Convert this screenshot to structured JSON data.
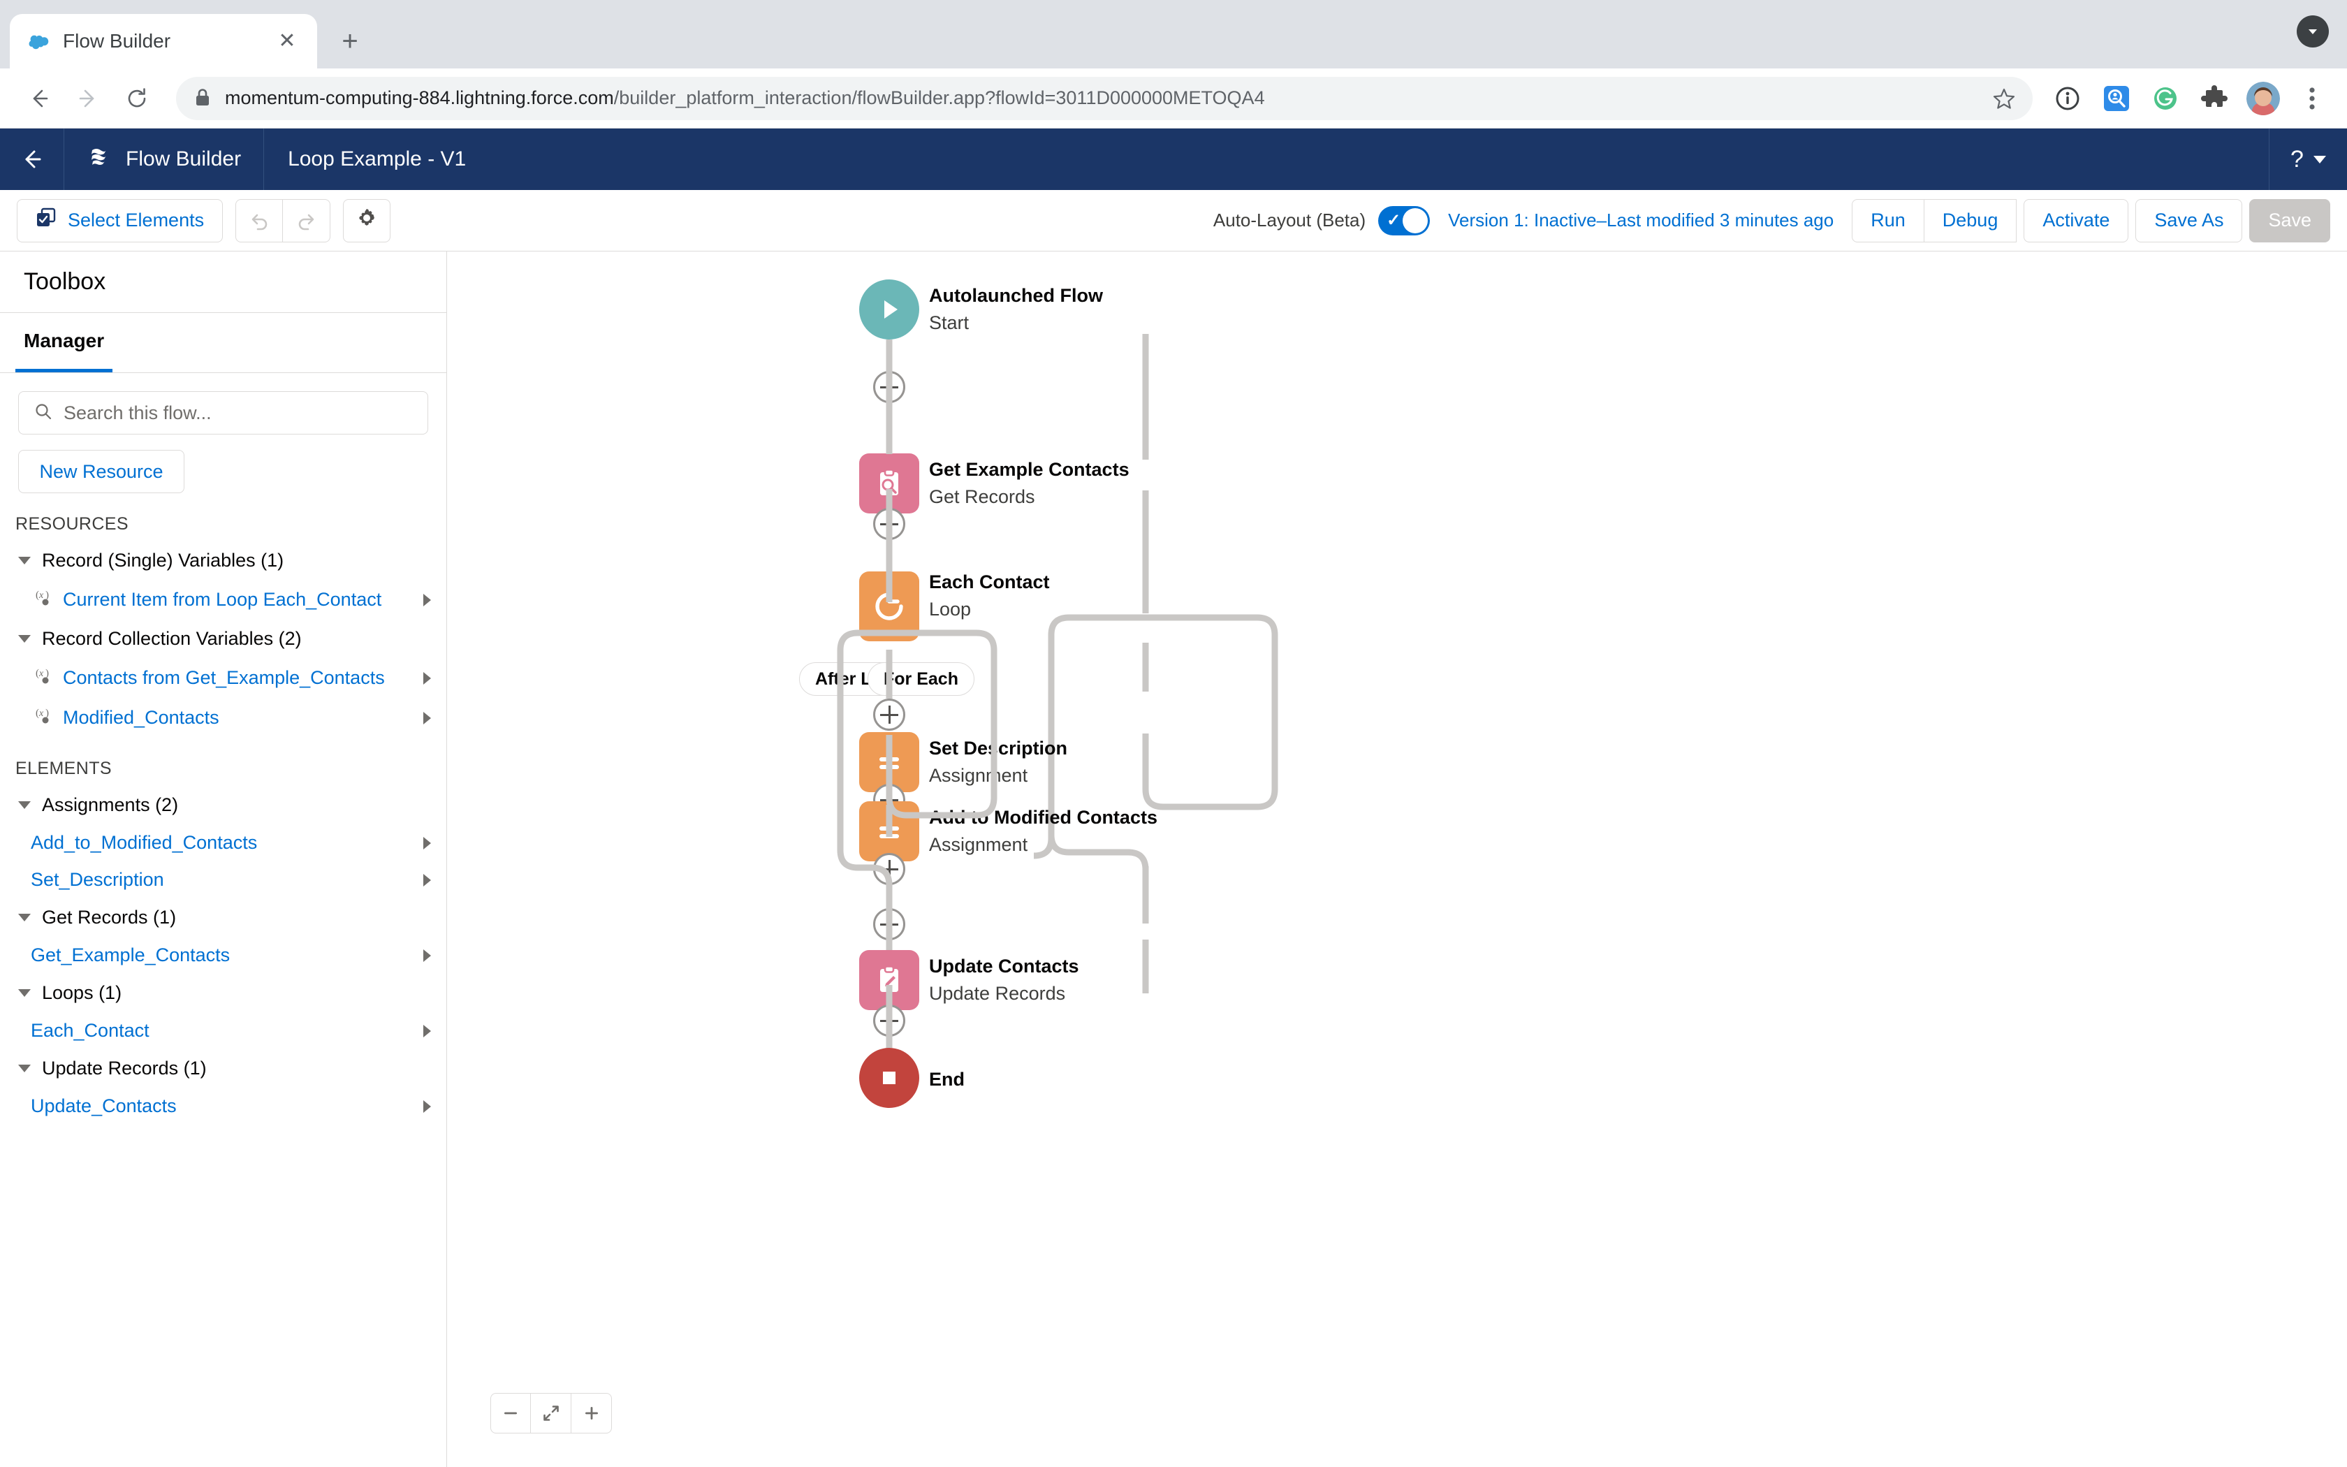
{
  "browser": {
    "tab": {
      "title": "Flow Builder",
      "favicon": "salesforce-cloud-icon",
      "close": "✕"
    },
    "new_tab": "+",
    "url": {
      "domain": "momentum-computing-884.lightning.force.com",
      "path": "/builder_platform_interaction/flowBuilder.app?flowId=3011D000000METOQA4"
    },
    "nav": {
      "back": "←",
      "forward": "→",
      "reload": "⟳"
    },
    "extensions": [
      "info-circle-icon",
      "search-person-icon",
      "grammarly-icon",
      "puzzle-extension-icon",
      "profile-avatar",
      "three-dot-menu-icon"
    ]
  },
  "sf_header": {
    "back_label": "←",
    "app_name": "Flow Builder",
    "app_icon": "flow-builder-icon",
    "flow_name": "Loop Example - V1",
    "help_label": "?"
  },
  "toolbar": {
    "select_elements": "Select Elements",
    "undo_label": "undo",
    "redo_label": "redo",
    "settings_label": "settings",
    "autolayout_label": "Auto-Layout (Beta)",
    "autolayout_on": true,
    "version_status": "Version 1: Inactive–Last modified 3 minutes ago",
    "run": "Run",
    "debug": "Debug",
    "activate": "Activate",
    "save_as": "Save As",
    "save": "Save"
  },
  "sidebar": {
    "title": "Toolbox",
    "tabs": [
      {
        "label": "Manager",
        "active": true
      }
    ],
    "search_placeholder": "Search this flow...",
    "new_resource": "New Resource",
    "resources_label": "RESOURCES",
    "resource_groups": [
      {
        "label": "Record (Single) Variables (1)",
        "items": [
          {
            "label": "Current Item from Loop Each_Contact",
            "icon": "variable-icon"
          }
        ]
      },
      {
        "label": "Record Collection Variables (2)",
        "items": [
          {
            "label": "Contacts from Get_Example_Contacts",
            "icon": "variable-icon"
          },
          {
            "label": "Modified_Contacts",
            "icon": "variable-icon"
          }
        ]
      }
    ],
    "elements_label": "ELEMENTS",
    "element_groups": [
      {
        "label": "Assignments (2)",
        "items": [
          {
            "label": "Add_to_Modified_Contacts"
          },
          {
            "label": "Set_Description"
          }
        ]
      },
      {
        "label": "Get Records (1)",
        "items": [
          {
            "label": "Get_Example_Contacts"
          }
        ]
      },
      {
        "label": "Loops (1)",
        "items": [
          {
            "label": "Each_Contact"
          }
        ]
      },
      {
        "label": "Update Records (1)",
        "items": [
          {
            "label": "Update_Contacts"
          }
        ]
      }
    ]
  },
  "canvas": {
    "nodes": [
      {
        "id": "start",
        "title": "Autolaunched Flow",
        "subtitle": "Start",
        "icon": "play-icon",
        "color": "#6BB7B7",
        "shape": "round"
      },
      {
        "id": "get_records",
        "title": "Get Example Contacts",
        "subtitle": "Get Records",
        "icon": "clipboard-search-icon",
        "color": "#DF7793",
        "shape": "rounded"
      },
      {
        "id": "loop",
        "title": "Each Contact",
        "subtitle": "Loop",
        "icon": "loop-refresh-icon",
        "color": "#EE9A54",
        "shape": "rounded"
      },
      {
        "id": "set_description",
        "title": "Set Description",
        "subtitle": "Assignment",
        "icon": "equals-icon",
        "color": "#EE9A54",
        "shape": "rounded"
      },
      {
        "id": "add_to_modified",
        "title": "Add to Modified Contacts",
        "subtitle": "Assignment",
        "icon": "equals-icon",
        "color": "#EE9A54",
        "shape": "rounded"
      },
      {
        "id": "update_records",
        "title": "Update Contacts",
        "subtitle": "Update Records",
        "icon": "clipboard-edit-icon",
        "color": "#DF7793",
        "shape": "rounded"
      },
      {
        "id": "end",
        "title": "End",
        "subtitle": "",
        "icon": "stop-square-icon",
        "color": "#C2443D",
        "shape": "round"
      }
    ],
    "branch_labels": [
      {
        "id": "after_last",
        "label": "After Last"
      },
      {
        "id": "for_each",
        "label": "For Each"
      }
    ],
    "add_buttons": 6,
    "zoom_controls": {
      "zoom_out": "−",
      "fit": "fit-to-screen",
      "zoom_in": "+"
    }
  },
  "colors": {
    "sf_navy": "#1b3667",
    "link_blue": "#0070d2",
    "teal": "#6BB7B7",
    "pink": "#DF7793",
    "orange": "#EE9A54",
    "red": "#C2443D",
    "connector_gray": "#c9c7c5"
  }
}
